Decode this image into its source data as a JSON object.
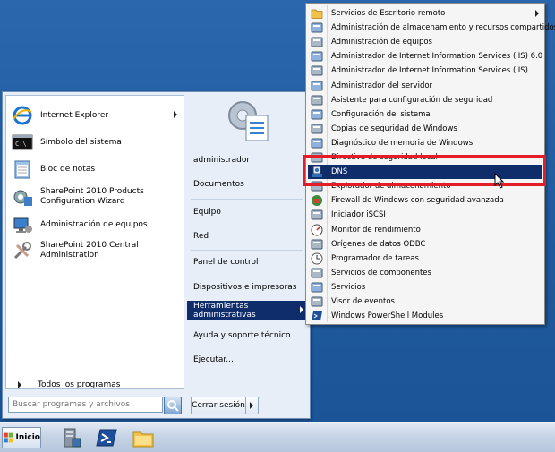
{
  "start_menu": {
    "pinned": [
      {
        "label": "Internet Explorer",
        "icon": "internet-explorer-icon",
        "has_submenu": true
      },
      {
        "label": "Símbolo del sistema",
        "icon": "command-prompt-icon"
      },
      {
        "label": "Bloc de notas",
        "icon": "notepad-icon"
      },
      {
        "label": "SharePoint 2010 Products Configuration Wizard",
        "icon": "sharepoint-config-icon"
      },
      {
        "label": "Administración de equipos",
        "icon": "computer-management-icon"
      },
      {
        "label": "SharePoint 2010 Central Administration",
        "icon": "sharepoint-admin-icon"
      }
    ],
    "all_programs": "Todos los programas",
    "search_placeholder": "Buscar programas y archivos",
    "right_items": [
      {
        "label": "administrador"
      },
      {
        "label": "Documentos"
      },
      {
        "label": "Equipo"
      },
      {
        "label": "Red"
      },
      {
        "label": "Panel de control"
      },
      {
        "label": "Dispositivos e impresoras"
      },
      {
        "label": "Herramientas administrativas",
        "active": true,
        "has_submenu": true
      },
      {
        "label": "Ayuda y soporte técnico"
      },
      {
        "label": "Ejecutar..."
      }
    ],
    "logoff_label": "Cerrar sesión"
  },
  "submenu": {
    "items": [
      {
        "label": "Servicios de Escritorio remoto",
        "icon": "folder-icon",
        "has_submenu": true
      },
      {
        "label": "Administración de almacenamiento y recursos compartidos",
        "icon": "storage-icon"
      },
      {
        "label": "Administración de equipos",
        "icon": "computer-management-icon"
      },
      {
        "label": "Administrador de Internet Information Services (IIS) 6.0",
        "icon": "iis6-icon"
      },
      {
        "label": "Administrador de Internet Information Services (IIS)",
        "icon": "iis-icon"
      },
      {
        "label": "Administrador del servidor",
        "icon": "server-manager-icon"
      },
      {
        "label": "Asistente para configuración de seguridad",
        "icon": "security-wizard-icon"
      },
      {
        "label": "Configuración del sistema",
        "icon": "system-config-icon"
      },
      {
        "label": "Copias de seguridad de Windows",
        "icon": "backup-icon"
      },
      {
        "label": "Diagnóstico de memoria de Windows",
        "icon": "memory-diagnostic-icon"
      },
      {
        "label": "Directiva de seguridad local",
        "icon": "local-policy-icon"
      },
      {
        "label": "DNS",
        "icon": "dns-icon",
        "highlighted": true
      },
      {
        "label": "Explorador de almacenamiento",
        "icon": "storage-explorer-icon"
      },
      {
        "label": "Firewall de Windows con seguridad avanzada",
        "icon": "firewall-icon"
      },
      {
        "label": "Iniciador iSCSI",
        "icon": "iscsi-icon"
      },
      {
        "label": "Monitor de rendimiento",
        "icon": "performance-monitor-icon"
      },
      {
        "label": "Orígenes de datos ODBC",
        "icon": "odbc-icon"
      },
      {
        "label": "Programador de tareas",
        "icon": "task-scheduler-icon"
      },
      {
        "label": "Servicios de componentes",
        "icon": "component-services-icon"
      },
      {
        "label": "Servicios",
        "icon": "services-icon"
      },
      {
        "label": "Visor de eventos",
        "icon": "event-viewer-icon"
      },
      {
        "label": "Windows PowerShell Modules",
        "icon": "powershell-icon"
      }
    ]
  },
  "taskbar": {
    "start_label": "Inicio",
    "pinned": [
      {
        "icon": "server-manager-icon"
      },
      {
        "icon": "powershell-icon"
      },
      {
        "icon": "explorer-folder-icon"
      }
    ]
  },
  "colors": {
    "desktop": "#1f5b9f",
    "highlight": "#0f2d6b",
    "annotation_border": "#e21d27"
  }
}
